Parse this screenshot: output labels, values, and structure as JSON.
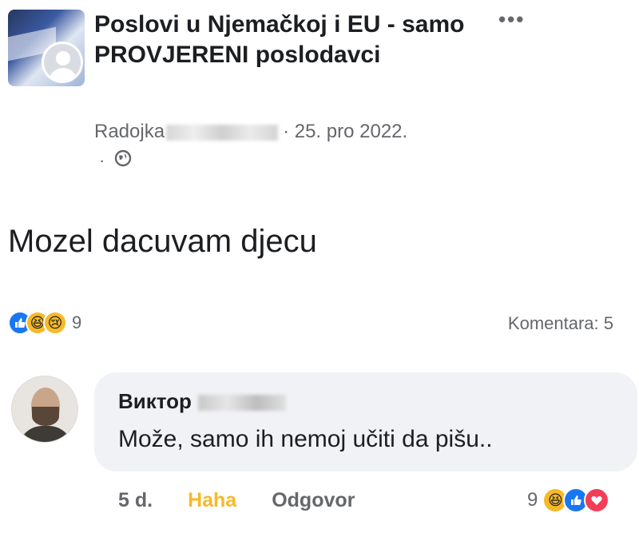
{
  "group": {
    "name": "Poslovi u Njemačkoj i EU - samo PROVJERENI poslodavci"
  },
  "post": {
    "author": "Radojka",
    "separator": "·",
    "date": "25. pro 2022.",
    "privacy_dot": "·",
    "text": "Mozel dacuvam djecu",
    "reaction_count": "9",
    "comments_label": "Komentara: 5"
  },
  "comment": {
    "author": "Виктор",
    "text": "Može, samo ih nemoj učiti da pišu..",
    "time": "5 d.",
    "haha_label": "Haha",
    "reply_label": "Odgovor",
    "reaction_count": "9"
  },
  "icons": {
    "more": "more-options-icon",
    "globe": "globe-icon",
    "reactions": [
      "like",
      "haha",
      "sad",
      "love"
    ]
  },
  "colors": {
    "like": "#1877f2",
    "haha": "#f7b928",
    "love": "#f33e58",
    "secondary_text": "#65676b",
    "bubble": "#f0f2f5"
  }
}
